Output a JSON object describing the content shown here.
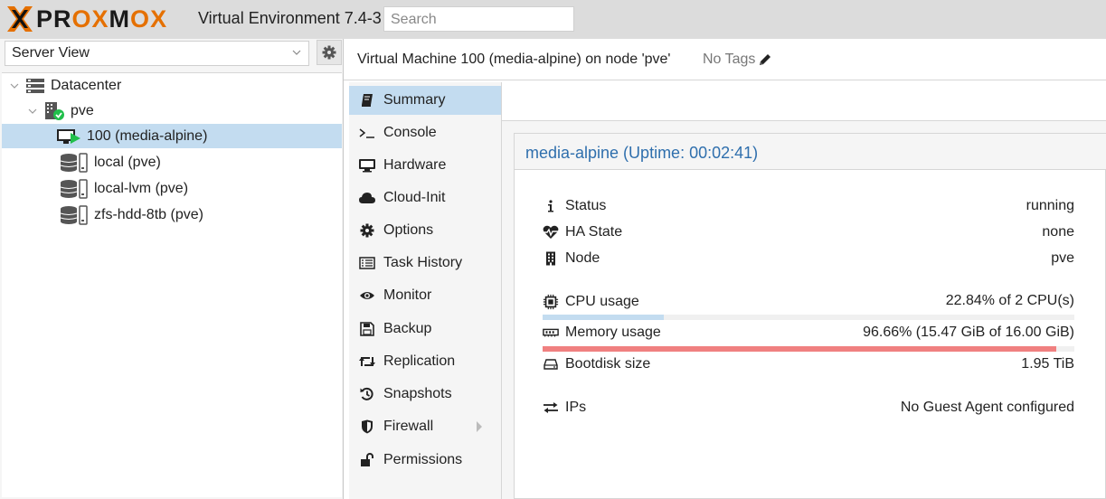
{
  "header": {
    "logo_text_pre": "",
    "logo_text": "PROXMOX",
    "product": "Virtual Environment 7.4-3",
    "search_placeholder": "Search"
  },
  "left": {
    "view_select": "Server View",
    "tree": [
      {
        "label": "Datacenter",
        "icon": "datacenter-icon"
      },
      {
        "label": "pve",
        "icon": "node-online-icon"
      },
      {
        "label": "100 (media-alpine)",
        "icon": "vm-running-icon",
        "selected": true
      },
      {
        "label": "local (pve)",
        "icon": "storage-icon"
      },
      {
        "label": "local-lvm (pve)",
        "icon": "storage-icon"
      },
      {
        "label": "zfs-hdd-8tb (pve)",
        "icon": "storage-icon"
      }
    ]
  },
  "vm_header": {
    "title": "Virtual Machine 100 (media-alpine) on node 'pve'",
    "tags": "No Tags"
  },
  "nav": [
    {
      "label": "Summary",
      "icon": "book-icon",
      "active": true
    },
    {
      "label": "Console",
      "icon": "terminal-icon"
    },
    {
      "label": "Hardware",
      "icon": "desktop-icon"
    },
    {
      "label": "Cloud-Init",
      "icon": "cloud-icon"
    },
    {
      "label": "Options",
      "icon": "gear-icon"
    },
    {
      "label": "Task History",
      "icon": "list-icon"
    },
    {
      "label": "Monitor",
      "icon": "eye-icon"
    },
    {
      "label": "Backup",
      "icon": "floppy-icon"
    },
    {
      "label": "Replication",
      "icon": "retweet-icon"
    },
    {
      "label": "Snapshots",
      "icon": "history-icon"
    },
    {
      "label": "Firewall",
      "icon": "shield-icon"
    },
    {
      "label": "Permissions",
      "icon": "unlock-icon"
    }
  ],
  "summary": {
    "title": "media-alpine (Uptime: 00:02:41)",
    "status_label": "Status",
    "status_value": "running",
    "ha_label": "HA State",
    "ha_value": "none",
    "node_label": "Node",
    "node_value": "pve",
    "cpu_label": "CPU usage",
    "cpu_value": "22.84% of 2 CPU(s)",
    "cpu_fraction": 0.2284,
    "mem_label": "Memory usage",
    "mem_value": "96.66% (15.47 GiB of 16.00 GiB)",
    "mem_fraction": 0.9666,
    "bootdisk_label": "Bootdisk size",
    "bootdisk_value": "1.95 TiB",
    "ips_label": "IPs",
    "ips_value": "No Guest Agent configured"
  },
  "colors": {
    "accent": "#2f6fad",
    "selection": "#c3dcf0",
    "logo_orange": "#e57000",
    "running_green": "#21bf4b",
    "cpu_bar": "#c3dcf0",
    "mem_bar": "#f08080"
  }
}
